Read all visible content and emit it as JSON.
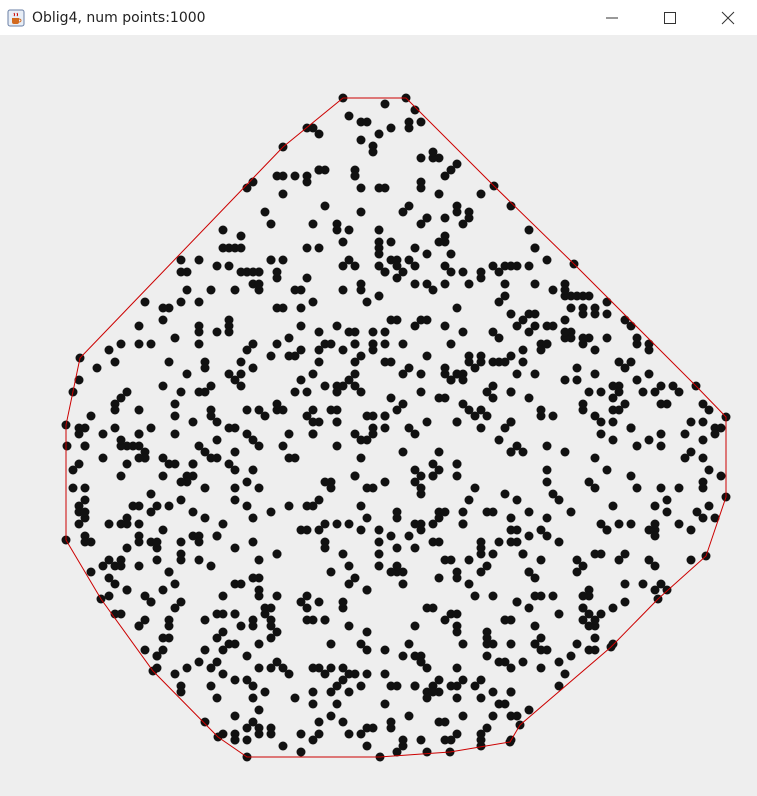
{
  "window": {
    "title": "Oblig4, num points:1000",
    "icons": {
      "app": "java-cup-icon",
      "minimize": "minimize-icon",
      "maximize": "maximize-icon",
      "close": "close-icon"
    }
  },
  "plot": {
    "point_color": "#111111",
    "hull_color": "#cc0000",
    "num_points": 1000
  }
}
